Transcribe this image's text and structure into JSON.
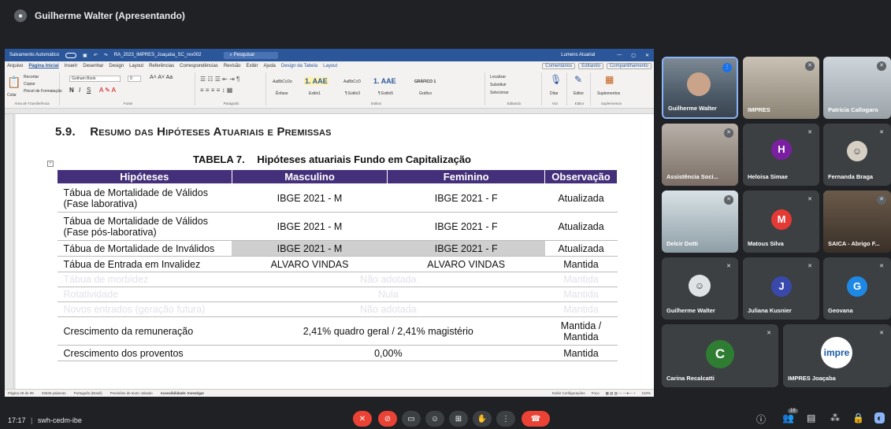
{
  "presenter": {
    "label": "Guilherme Walter (Apresentando)"
  },
  "word": {
    "titlebar": {
      "autosave": "Salvamento Automático",
      "filename": "RA_2023_IMPRES_Joaçaba_SC_rev002",
      "search_placeholder": "Pesquisar",
      "user": "Lumens Atuarial"
    },
    "menu": {
      "items": [
        "Arquivo",
        "Página Inicial",
        "Inserir",
        "Desenhar",
        "Design",
        "Layout",
        "Referências",
        "Correspondências",
        "Revisão",
        "Exibir",
        "Ajuda",
        "Design da Tabela",
        "Layout"
      ],
      "comments": "Comentários",
      "editing": "Editando",
      "share": "Compartilhamento"
    },
    "ribbon": {
      "paste": "Colar",
      "cut": "Recortar",
      "copy": "Copiar",
      "format_painter": "Pincel de Formatação",
      "clipboard_label": "Área de Transferência",
      "font_name": "Gotham Book",
      "font_size": "9",
      "font_label": "Fonte",
      "paragraph_label": "Parágrafo",
      "styles": [
        {
          "preview": "AaBbCcDo",
          "name": "Ênfase"
        },
        {
          "preview": "1. AAE",
          "name": "Estilo1"
        },
        {
          "preview": "AaBbCcD",
          "name": "¶ Estilo3"
        },
        {
          "preview": "1. AAE",
          "name": "¶ Estilo5"
        },
        {
          "preview": "GRÁFICO 1",
          "name": "Gráfico"
        }
      ],
      "styles_label": "Estilos",
      "find": "Localizar",
      "replace": "Substituir",
      "select": "Selecionar",
      "editing_label": "Editando",
      "dictate": "Ditar",
      "voice_label": "Voz",
      "editor": "Editor",
      "editor_label": "Editor",
      "addins": "Suplementos",
      "addins_label": "Suplementos"
    },
    "doc": {
      "heading_num": "5.9.",
      "heading": "Resumo das Hipóteses Atuariais e Premissas",
      "table_caption_label": "TABELA 7.",
      "table_caption": "Hipóteses atuariais Fundo em Capitalização",
      "table": {
        "headers": [
          "Hipóteses",
          "Masculino",
          "Feminino",
          "Observação"
        ],
        "rows": [
          {
            "h": "Tábua de Mortalidade de Válidos (Fase laborativa)",
            "m": "IBGE 2021 - M",
            "f": "IBGE 2021 - F",
            "o": "Atualizada"
          },
          {
            "h": "Tábua de Mortalidade de Válidos (Fase pós-laborativa)",
            "m": "IBGE 2021 - M",
            "f": "IBGE 2021 - F",
            "o": "Atualizada"
          },
          {
            "h": "Tábua de Mortalidade de Inválidos",
            "m": "IBGE 2021 - M",
            "f": "IBGE 2021 - F",
            "o": "Atualizada"
          },
          {
            "h": "Tábua de Entrada em Invalidez",
            "m": "ALVARO VINDAS",
            "f": "ALVARO VINDAS",
            "o": "Mantida"
          },
          {
            "h": "Tábua de morbidez",
            "mf": "Não adotada",
            "o": "Mantida"
          },
          {
            "h": "Rotatividade",
            "mf": "Nula",
            "o": "Mantida"
          },
          {
            "h": "Novos entrados (geração futura)",
            "mf": "Não adotada",
            "o": "Mantida"
          },
          {
            "h": "Crescimento da remuneração",
            "mf": "2,41% quadro geral / 2,41% magistério",
            "o": "Mantida / Mantida"
          },
          {
            "h": "Crescimento dos proventos",
            "mf": "0,00%",
            "o": "Mantida"
          }
        ]
      }
    },
    "status": {
      "page": "Página 29 de 99",
      "words": "33636 palavras",
      "lang": "Português (Brasil)",
      "predictions": "Previsões de texto: ativado",
      "accessibility": "Acessibilidade: Investigar",
      "display": "Exibir Configurações",
      "focus": "Foco",
      "zoom": "210%"
    }
  },
  "participants": [
    {
      "name": "Guilherme Walter"
    },
    {
      "name": "IMPRES"
    },
    {
      "name": "Patricia Callogaro"
    },
    {
      "name": "Assistência Soci..."
    },
    {
      "name": "Heloisa Simae",
      "initial": "H",
      "color": "#7b1fa2"
    },
    {
      "name": "Fernanda Braga"
    },
    {
      "name": "Delcir Dotti"
    },
    {
      "name": "Matous Silva",
      "initial": "M",
      "color": "#e53935"
    },
    {
      "name": "SAICA - Abrigo F..."
    },
    {
      "name": "Guilherme Walter"
    },
    {
      "name": "Juliana Kusnier",
      "initial": "J",
      "color": "#3949ab"
    },
    {
      "name": "Geovana",
      "initial": "G",
      "color": "#1e88e5"
    },
    {
      "name": "Carina Recalcatti",
      "initial": "C",
      "color": "#2e7d32"
    },
    {
      "name": "IMPRES Joaçaba",
      "logo": "impre"
    }
  ],
  "bottombar": {
    "time": "17:17",
    "meeting": "swh-cedm-ibe",
    "participants_count": "16"
  }
}
